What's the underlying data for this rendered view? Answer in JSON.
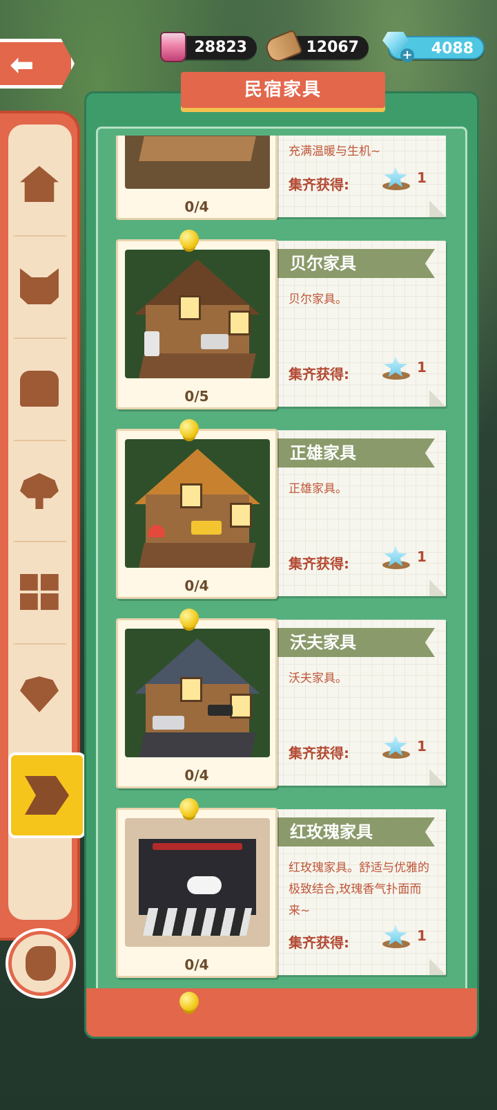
{
  "resources": {
    "ink": {
      "value": "28823",
      "icon": "pink-ink-bottle-icon"
    },
    "wood": {
      "value": "12067",
      "icon": "wood-log-icon"
    },
    "gems": {
      "value": "4088",
      "icon": "blue-gem-icon",
      "add": "+"
    }
  },
  "header": {
    "title": "民宿家具",
    "back_icon": "back-arrow-icon"
  },
  "sidebar": {
    "tabs": [
      {
        "name": "house",
        "icon": "house-icon"
      },
      {
        "name": "cat",
        "icon": "cat-icon"
      },
      {
        "name": "chest",
        "icon": "chest-icon"
      },
      {
        "name": "tree",
        "icon": "tree-icon"
      },
      {
        "name": "grid",
        "icon": "grid-icon"
      },
      {
        "name": "shell",
        "icon": "shell-icon"
      },
      {
        "name": "furniture",
        "icon": "furniture-tag-icon",
        "active": true
      }
    ],
    "hand_icon": "pointing-hand-icon"
  },
  "cards": [
    {
      "name": "",
      "desc": "充满温暖与生机~",
      "progress": "0/4",
      "reward_label": "集齐获得:",
      "reward_count": "1"
    },
    {
      "name": "贝尔家具",
      "desc": "贝尔家具。",
      "progress": "0/5",
      "reward_label": "集齐获得:",
      "reward_count": "1"
    },
    {
      "name": "正雄家具",
      "desc": "正雄家具。",
      "progress": "0/4",
      "reward_label": "集齐获得:",
      "reward_count": "1"
    },
    {
      "name": "沃夫家具",
      "desc": "沃夫家具。",
      "progress": "0/4",
      "reward_label": "集齐获得:",
      "reward_count": "1"
    },
    {
      "name": "红玫瑰家具",
      "desc": "红玫瑰家具。舒适与优雅的极致结合,玫瑰香气扑面而来~",
      "progress": "0/4",
      "reward_label": "集齐获得:",
      "reward_count": "1"
    }
  ],
  "colors": {
    "panel": "#3e9c6b",
    "accent": "#e2674b",
    "active_tab": "#f6c51b"
  }
}
